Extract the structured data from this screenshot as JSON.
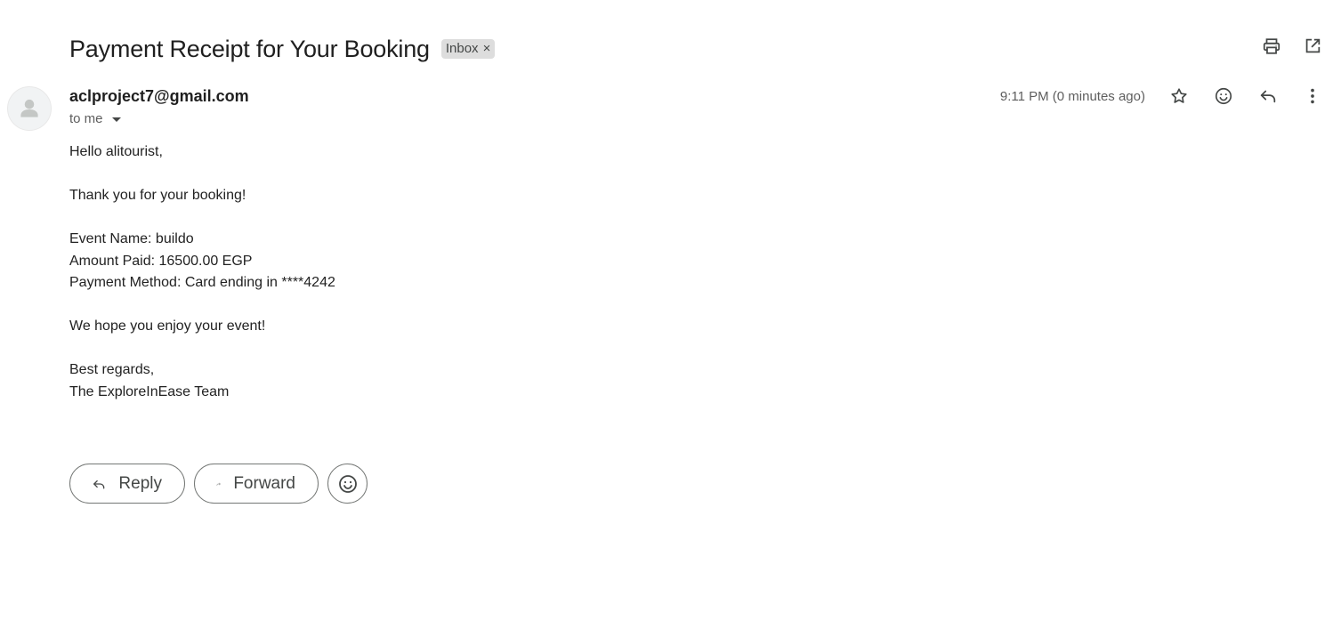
{
  "email": {
    "subject": "Payment Receipt for Your Booking",
    "label": "Inbox",
    "label_remove": "×",
    "sender": "aclproject7@gmail.com",
    "recipient": "to me",
    "timestamp": "9:11 PM (0 minutes ago)",
    "body": {
      "greeting": "Hello alitourist,",
      "thanks": "Thank you for your booking!",
      "event_name": "Event Name: buildo",
      "amount_paid": "Amount Paid: 16500.00 EGP",
      "payment_method": "Payment Method: Card ending in ****4242",
      "enjoy": "We hope you enjoy your event!",
      "signoff": "Best regards,",
      "signature": "The ExploreInEase Team"
    }
  },
  "actions": {
    "reply_label": "Reply",
    "forward_label": "Forward"
  },
  "icons": {
    "print": "print-icon",
    "open_new_window": "open-in-new-window-icon",
    "star": "star-icon",
    "emoji": "emoji-reaction-icon",
    "reply": "reply-icon",
    "more": "more-vertical-icon",
    "forward": "forward-icon",
    "avatar": "default-avatar-icon"
  },
  "colors": {
    "text": "#1f1f1f",
    "secondary_text": "#5e5e5e",
    "chip_bg": "#dddddd",
    "button_border": "#747775"
  }
}
